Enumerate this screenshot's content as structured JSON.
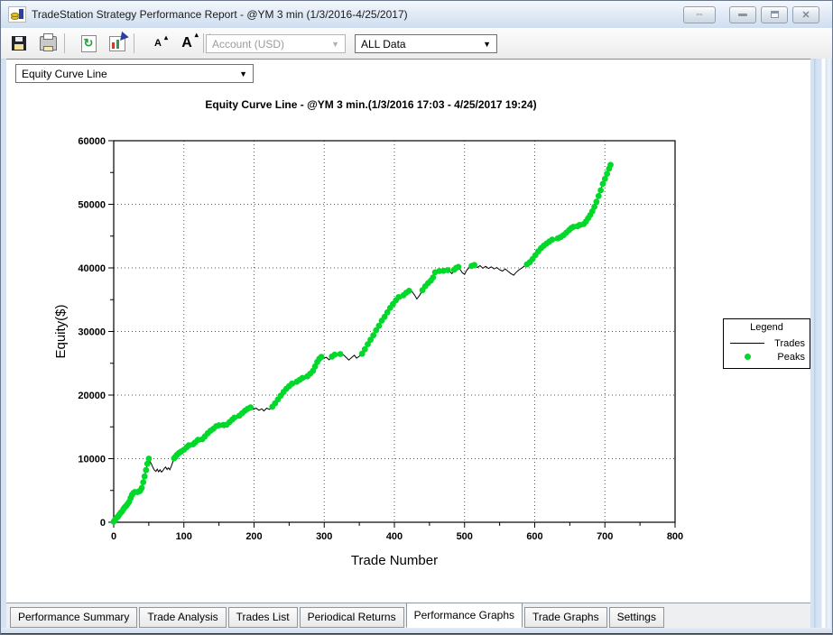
{
  "window": {
    "title": "TradeStation Strategy Performance Report - @YM 3 min (1/3/2016-4/25/2017)",
    "controls": {
      "resize_glyph": "⇔",
      "close_glyph": "✕"
    }
  },
  "toolbar": {
    "font_small_label": "A",
    "font_large_label": "A",
    "caret_glyph": "▴",
    "refresh_glyph": "↻",
    "account_dropdown": {
      "value": "Account (USD)",
      "disabled": true,
      "arrow": "▼"
    },
    "data_dropdown": {
      "value": "ALL Data",
      "arrow": "▼"
    },
    "graph_type_dropdown": {
      "value": "Equity Curve Line",
      "arrow": "▼"
    }
  },
  "legend": {
    "title": "Legend",
    "entries": [
      {
        "label": "Trades",
        "type": "line",
        "color": "#000000"
      },
      {
        "label": "Peaks",
        "type": "dot",
        "color": "#00d82a"
      }
    ]
  },
  "tabs": {
    "active_index": 4,
    "items": [
      {
        "label": "Performance Summary"
      },
      {
        "label": "Trade Analysis"
      },
      {
        "label": "Trades List"
      },
      {
        "label": "Periodical Returns"
      },
      {
        "label": "Performance Graphs"
      },
      {
        "label": "Trade Graphs"
      },
      {
        "label": "Settings"
      }
    ]
  },
  "chart_data": {
    "type": "line",
    "title": "Equity Curve Line - @YM 3 min.(1/3/2016 17:03 - 4/25/2017 19:24)",
    "xlabel": "Trade Number",
    "ylabel": "Equity($)",
    "xlim": [
      0,
      800
    ],
    "ylim": [
      0,
      60000
    ],
    "x_major": 100,
    "x_minor": 50,
    "y_major": 10000,
    "y_minor": 5000,
    "grid": "dotted",
    "legend_position": "right-outside",
    "series": [
      {
        "name": "Trades",
        "type": "line",
        "color": "#000000",
        "points": [
          [
            0,
            100
          ],
          [
            2,
            400
          ],
          [
            4,
            700
          ],
          [
            6,
            900
          ],
          [
            8,
            1200
          ],
          [
            10,
            1500
          ],
          [
            12,
            1700
          ],
          [
            14,
            2100
          ],
          [
            16,
            2400
          ],
          [
            18,
            2600
          ],
          [
            20,
            2900
          ],
          [
            22,
            3200
          ],
          [
            24,
            3800
          ],
          [
            26,
            4300
          ],
          [
            28,
            4600
          ],
          [
            30,
            4750
          ],
          [
            32,
            4650
          ],
          [
            34,
            4750
          ],
          [
            36,
            4850
          ],
          [
            38,
            5000
          ],
          [
            40,
            5400
          ],
          [
            42,
            6300
          ],
          [
            44,
            7200
          ],
          [
            46,
            8200
          ],
          [
            48,
            9200
          ],
          [
            50,
            10000
          ],
          [
            52,
            9500
          ],
          [
            54,
            9100
          ],
          [
            56,
            8600
          ],
          [
            58,
            8200
          ],
          [
            60,
            8000
          ],
          [
            62,
            8350
          ],
          [
            64,
            7950
          ],
          [
            66,
            8250
          ],
          [
            68,
            7900
          ],
          [
            70,
            8100
          ],
          [
            72,
            8450
          ],
          [
            74,
            8700
          ],
          [
            76,
            8300
          ],
          [
            78,
            8550
          ],
          [
            80,
            8250
          ],
          [
            82,
            8800
          ],
          [
            84,
            9400
          ],
          [
            86,
            10050
          ],
          [
            88,
            10300
          ],
          [
            90,
            10600
          ],
          [
            93,
            10900
          ],
          [
            96,
            11100
          ],
          [
            100,
            11400
          ],
          [
            104,
            11800
          ],
          [
            107,
            12100
          ],
          [
            110,
            11850
          ],
          [
            113,
            12250
          ],
          [
            116,
            12550
          ],
          [
            120,
            12950
          ],
          [
            123,
            12650
          ],
          [
            126,
            13050
          ],
          [
            130,
            13500
          ],
          [
            134,
            14000
          ],
          [
            138,
            14400
          ],
          [
            142,
            14700
          ],
          [
            146,
            15100
          ],
          [
            150,
            15250
          ],
          [
            153,
            14950
          ],
          [
            156,
            15300
          ],
          [
            158,
            14900
          ],
          [
            161,
            15350
          ],
          [
            165,
            15750
          ],
          [
            169,
            16150
          ],
          [
            172,
            16450
          ],
          [
            175,
            16250
          ],
          [
            179,
            16750
          ],
          [
            183,
            17150
          ],
          [
            187,
            17550
          ],
          [
            191,
            17850
          ],
          [
            195,
            18050
          ],
          [
            199,
            17750
          ],
          [
            203,
            17950
          ],
          [
            207,
            17600
          ],
          [
            211,
            17850
          ],
          [
            214,
            17500
          ],
          [
            218,
            17950
          ],
          [
            222,
            17750
          ],
          [
            226,
            18150
          ],
          [
            230,
            18700
          ],
          [
            234,
            19300
          ],
          [
            238,
            19900
          ],
          [
            242,
            20500
          ],
          [
            246,
            21000
          ],
          [
            250,
            21400
          ],
          [
            254,
            21800
          ],
          [
            257,
            21550
          ],
          [
            261,
            22100
          ],
          [
            265,
            22400
          ],
          [
            269,
            22700
          ],
          [
            272,
            22450
          ],
          [
            276,
            22950
          ],
          [
            280,
            23350
          ],
          [
            284,
            23800
          ],
          [
            287,
            24500
          ],
          [
            290,
            25200
          ],
          [
            293,
            25700
          ],
          [
            296,
            26000
          ],
          [
            299,
            25750
          ],
          [
            303,
            25950
          ],
          [
            307,
            25550
          ],
          [
            311,
            26050
          ],
          [
            315,
            26350
          ],
          [
            319,
            26250
          ],
          [
            323,
            26450
          ],
          [
            327,
            26350
          ],
          [
            331,
            25950
          ],
          [
            335,
            25500
          ],
          [
            339,
            25900
          ],
          [
            343,
            26250
          ],
          [
            346,
            25800
          ],
          [
            350,
            26100
          ],
          [
            354,
            26500
          ],
          [
            358,
            27200
          ],
          [
            362,
            28000
          ],
          [
            366,
            28700
          ],
          [
            370,
            29400
          ],
          [
            374,
            30200
          ],
          [
            378,
            30900
          ],
          [
            382,
            31700
          ],
          [
            386,
            32300
          ],
          [
            390,
            33000
          ],
          [
            394,
            33700
          ],
          [
            398,
            34300
          ],
          [
            402,
            34900
          ],
          [
            406,
            35400
          ],
          [
            409,
            35150
          ],
          [
            413,
            35700
          ],
          [
            417,
            36100
          ],
          [
            421,
            36400
          ],
          [
            425,
            36300
          ],
          [
            429,
            35700
          ],
          [
            432,
            35100
          ],
          [
            436,
            35700
          ],
          [
            440,
            36500
          ],
          [
            444,
            37100
          ],
          [
            448,
            37600
          ],
          [
            452,
            38000
          ],
          [
            455,
            38500
          ],
          [
            458,
            39300
          ],
          [
            461,
            39200
          ],
          [
            464,
            39500
          ],
          [
            467,
            39250
          ],
          [
            470,
            39550
          ],
          [
            473,
            39350
          ],
          [
            476,
            39650
          ],
          [
            479,
            39400
          ],
          [
            482,
            39100
          ],
          [
            485,
            39700
          ],
          [
            488,
            40000
          ],
          [
            491,
            40150
          ],
          [
            494,
            39700
          ],
          [
            497,
            39200
          ],
          [
            500,
            39000
          ],
          [
            503,
            39600
          ],
          [
            506,
            40000
          ],
          [
            510,
            40300
          ],
          [
            514,
            40450
          ],
          [
            518,
            40050
          ],
          [
            522,
            40350
          ],
          [
            526,
            39950
          ],
          [
            530,
            40250
          ],
          [
            534,
            39900
          ],
          [
            538,
            40150
          ],
          [
            542,
            39850
          ],
          [
            546,
            40050
          ],
          [
            550,
            39700
          ],
          [
            554,
            39500
          ],
          [
            558,
            39850
          ],
          [
            562,
            39450
          ],
          [
            566,
            39100
          ],
          [
            570,
            38850
          ],
          [
            573,
            39250
          ],
          [
            577,
            39650
          ],
          [
            581,
            39950
          ],
          [
            585,
            40250
          ],
          [
            589,
            40550
          ],
          [
            593,
            40900
          ],
          [
            597,
            41400
          ],
          [
            601,
            42000
          ],
          [
            605,
            42600
          ],
          [
            609,
            43100
          ],
          [
            613,
            43500
          ],
          [
            617,
            43850
          ],
          [
            621,
            44150
          ],
          [
            625,
            44450
          ],
          [
            629,
            44350
          ],
          [
            633,
            44650
          ],
          [
            637,
            44850
          ],
          [
            641,
            45150
          ],
          [
            645,
            45550
          ],
          [
            649,
            45950
          ],
          [
            652,
            46250
          ],
          [
            655,
            46450
          ],
          [
            658,
            46200
          ],
          [
            661,
            46550
          ],
          [
            664,
            46750
          ],
          [
            667,
            46450
          ],
          [
            670,
            46900
          ],
          [
            673,
            47300
          ],
          [
            676,
            47800
          ],
          [
            679,
            48300
          ],
          [
            682,
            48900
          ],
          [
            685,
            49600
          ],
          [
            688,
            50400
          ],
          [
            691,
            51300
          ],
          [
            694,
            52200
          ],
          [
            697,
            53200
          ],
          [
            700,
            54000
          ],
          [
            703,
            54800
          ],
          [
            706,
            55600
          ],
          [
            708,
            56200
          ]
        ]
      },
      {
        "name": "Peaks",
        "type": "scatter",
        "color": "#00d82a",
        "derived": "new-equity-high points (running maximum of Trades series)"
      }
    ]
  }
}
